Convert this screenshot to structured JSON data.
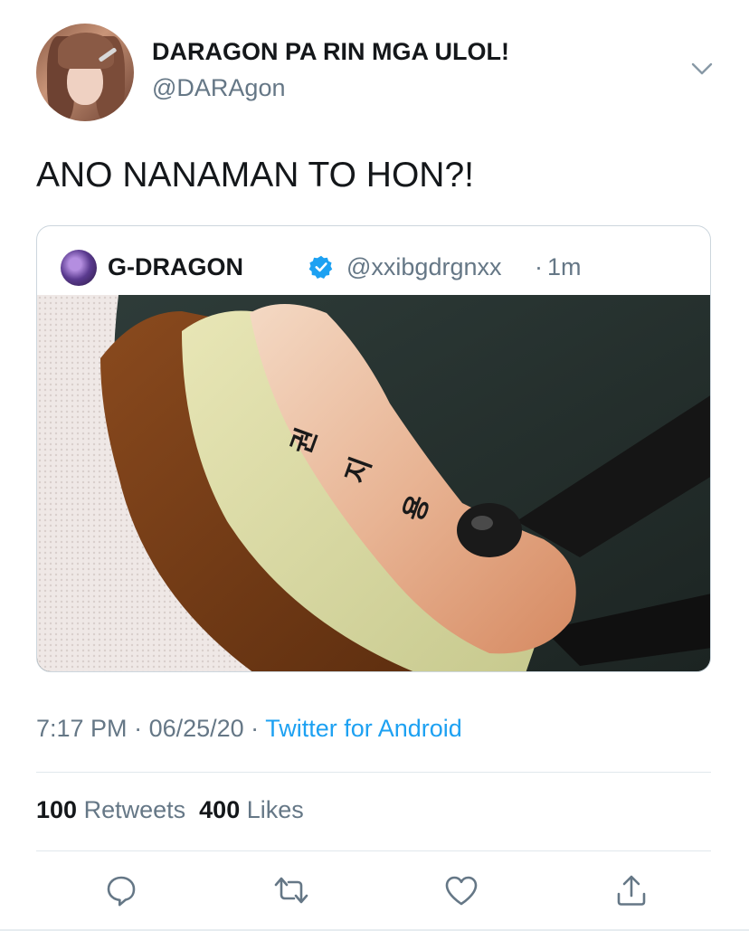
{
  "tweet": {
    "author": {
      "display_name": "DARAGON PA RIN MGA ULOL!",
      "handle": "@DARAgon"
    },
    "text": "ANO NANAMAN TO HON?!",
    "quoted": {
      "display_name": "G-DRAGON",
      "handle": "@xxibgdrgnxx",
      "separator": "·",
      "time": "1m",
      "photo_markings": [
        "권",
        "지",
        "용"
      ]
    },
    "meta": {
      "time": "7:17 PM",
      "dot1": " · ",
      "date": "06/25/20",
      "dot2": " · ",
      "source": "Twitter for Android"
    },
    "stats": {
      "retweets_count": "100",
      "retweets_label": "Retweets",
      "likes_count": "400",
      "likes_label": "Likes"
    }
  },
  "colors": {
    "text": "#14171a",
    "secondary": "#657786",
    "accent": "#1da1f2",
    "divider": "#e1e8ed"
  },
  "icons": {
    "caret": "chevron-down-icon",
    "verified": "verified-badge-icon",
    "reply": "reply-icon",
    "retweet": "retweet-icon",
    "like": "heart-icon",
    "share": "share-icon"
  }
}
